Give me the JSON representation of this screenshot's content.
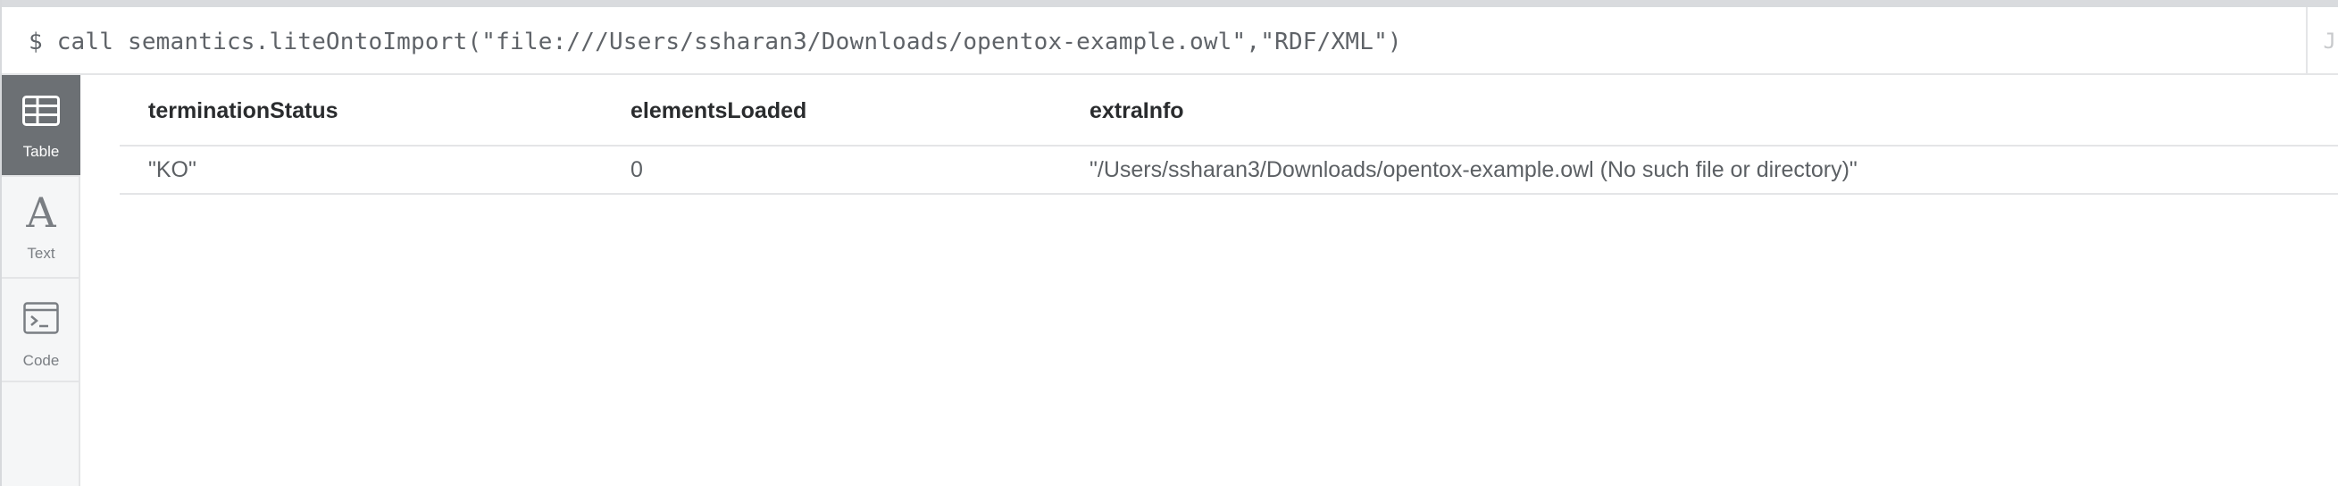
{
  "command": {
    "text": "$ call semantics.liteOntoImport(\"file:///Users/ssharan3/Downloads/opentox-example.owl\",\"RDF/XML\")",
    "edge_glyph": "J"
  },
  "sidebar": {
    "items": [
      {
        "label": "Table",
        "icon": "table-icon",
        "active": true
      },
      {
        "label": "Text",
        "icon": "text-a-icon",
        "active": false
      },
      {
        "label": "Code",
        "icon": "terminal-icon",
        "active": false
      }
    ]
  },
  "table": {
    "headers": [
      "terminationStatus",
      "elementsLoaded",
      "extraInfo"
    ],
    "rows": [
      [
        "\"KO\"",
        "0",
        "\"/Users/ssharan3/Downloads/opentox-example.owl (No such file or directory)\""
      ]
    ]
  },
  "colors": {
    "active_tab": "#6c7074",
    "sidebar_bg": "#f5f6f7",
    "border": "#e4e5e7"
  }
}
